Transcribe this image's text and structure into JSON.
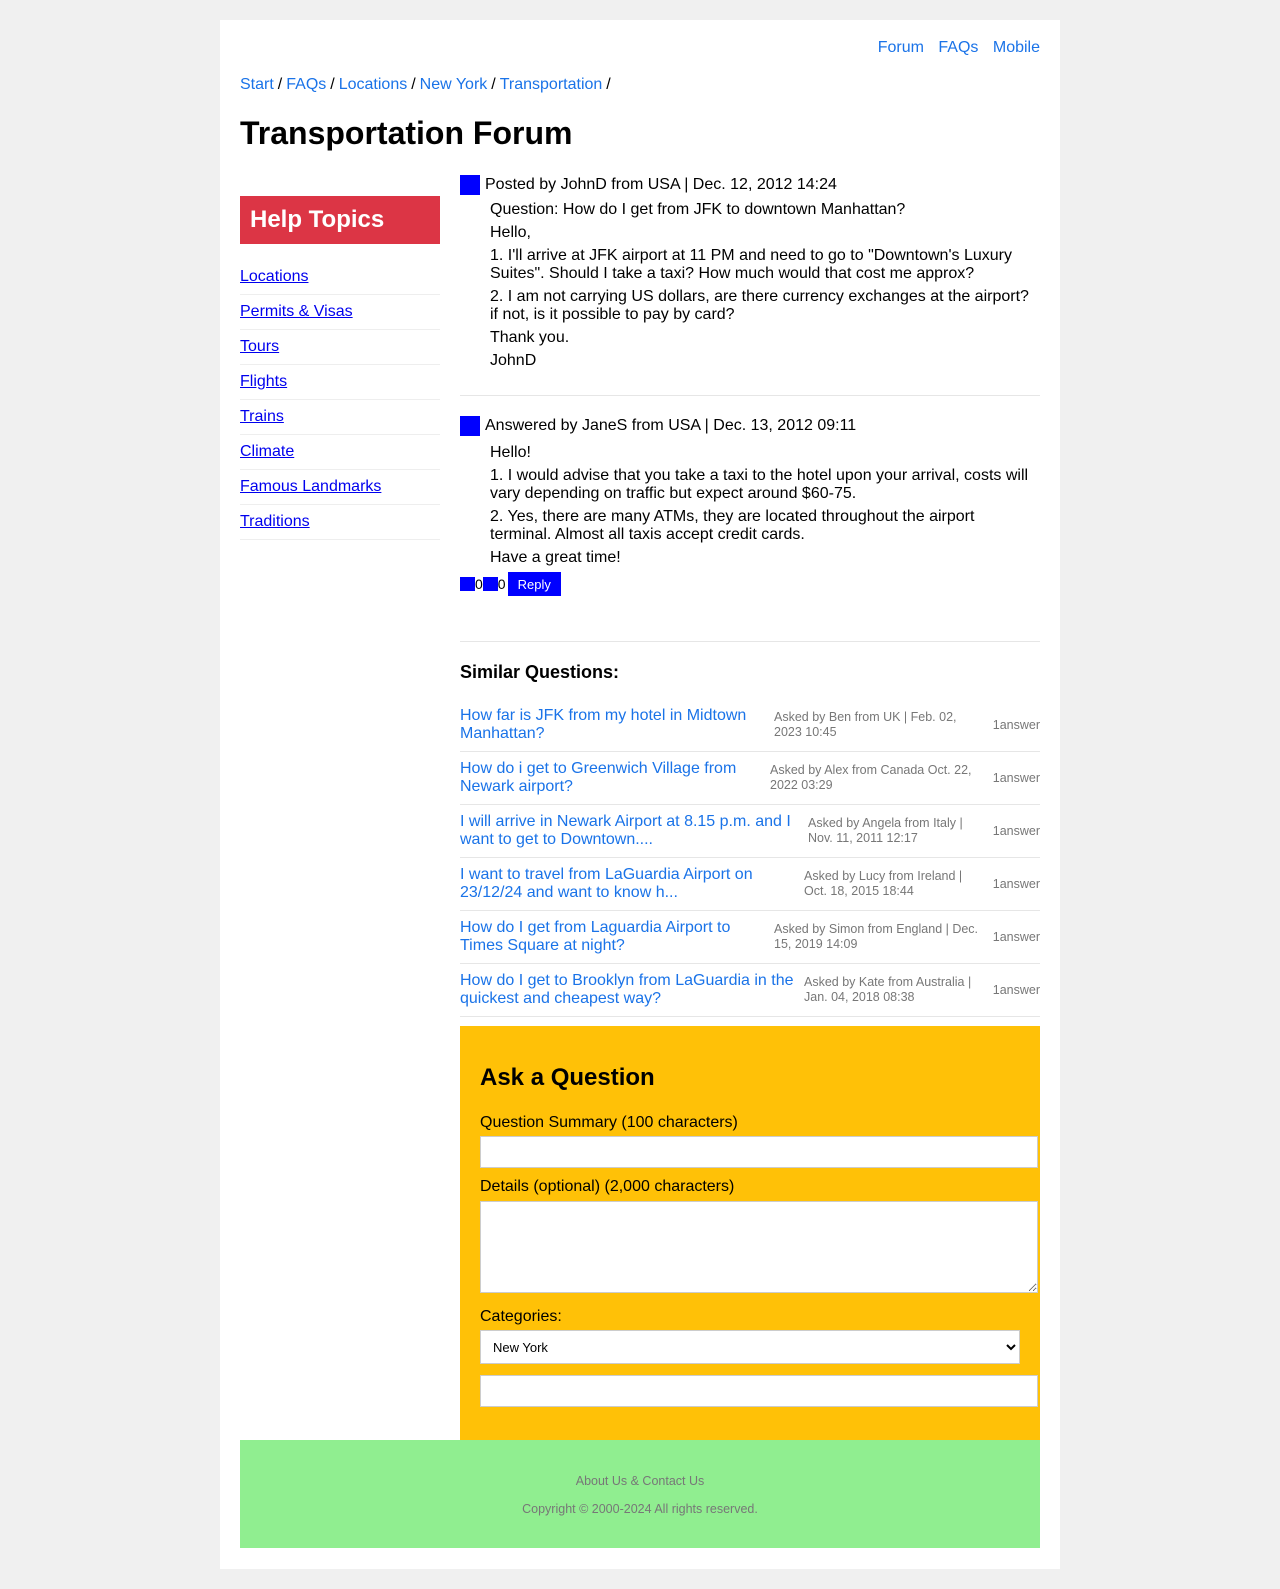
{
  "topnav": [
    "Forum",
    "FAQs",
    "Mobile"
  ],
  "breadcrumb": [
    "Start",
    "FAQs",
    "Locations",
    "New York",
    "Transportation"
  ],
  "breadcrumb_sep": "/",
  "title": "Transportation Forum",
  "sidebar": {
    "heading": "Help Topics",
    "items": [
      "Locations",
      "Permits & Visas",
      "Tours",
      "Flights",
      "Trains",
      "Climate",
      "Famous Landmarks",
      "Traditions"
    ]
  },
  "question": {
    "meta": "Posted by JohnD from USA | Dec. 12, 2012 14:24",
    "lines": [
      "Question: How do I get from JFK to downtown Manhattan?",
      "Hello,",
      "1. I'll arrive at JFK airport at 11 PM and need to go to \"Downtown's Luxury Suites\". Should I take a taxi? How much would that cost me approx?",
      "2. I am not carrying US dollars, are there currency exchanges at the airport? if not, is it possible to pay by card?",
      "Thank you.",
      "JohnD"
    ]
  },
  "answer": {
    "meta": "Answered by JaneS from USA | Dec. 13, 2012 09:11",
    "lines": [
      "Hello!",
      "1. I would advise that you take a taxi to the hotel upon your arrival, costs will vary depending on traffic but expect around $60-75.",
      "2. Yes, there are many ATMs, they are located throughout the airport terminal. Almost all taxis accept credit cards.",
      "Have a great time!"
    ],
    "upvotes": "0",
    "downvotes": "0",
    "reply_label": "Reply"
  },
  "similar": {
    "heading": "Similar Questions:",
    "items": [
      {
        "title": "How far is JFK from my hotel in Midtown Manhattan?",
        "meta": "Asked by Ben from UK | Feb. 02, 2023 10:45",
        "answers": "1answer"
      },
      {
        "title": "How do i get to Greenwich Village from Newark airport?",
        "meta": "Asked by Alex from Canada Oct. 22, 2022 03:29",
        "answers": "1answer"
      },
      {
        "title": "I will arrive in Newark Airport at 8.15 p.m. and I want to get to Downtown....",
        "meta": "Asked by Angela from Italy | Nov. 11, 2011 12:17",
        "answers": "1answer"
      },
      {
        "title": "I want to travel from LaGuardia Airport on 23/12/24 and want to know h...",
        "meta": "Asked by Lucy from Ireland | Oct. 18, 2015 18:44",
        "answers": "1answer"
      },
      {
        "title": "How do I get from Laguardia Airport to Times Square at night?",
        "meta": "Asked by Simon from England | Dec. 15, 2019 14:09",
        "answers": "1answer"
      },
      {
        "title": "How do I get to Brooklyn from LaGuardia in the quickest and cheapest way?",
        "meta": "Asked by Kate from Australia | Jan. 04, 2018 08:38",
        "answers": "1answer"
      }
    ]
  },
  "ask": {
    "heading": "Ask a Question",
    "summary_label": "Question Summary (100 characters)",
    "summary_value": "",
    "details_label": "Details (optional) (2,000 characters)",
    "details_value": "",
    "categories_label": "Categories:",
    "category_selected": "New York",
    "extra_value": ""
  },
  "footer": {
    "links": "About Us & Contact Us",
    "copyright": "Copyright © 2000-2024 All rights reserved."
  },
  "colors": {
    "link": "#1a73e8",
    "sidebar_heading_bg": "#dc3545",
    "ask_bg": "#ffc107",
    "footer_bg": "#90ee90",
    "vote_square": "#0000ff"
  }
}
